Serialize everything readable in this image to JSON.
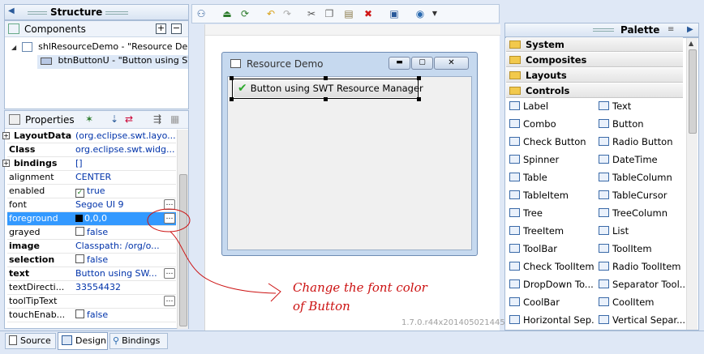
{
  "structure": {
    "title": "Structure",
    "components_label": "Components",
    "tree": [
      "shlResourceDemo - \"Resource Demo\"",
      "btnButtonU - \"Button using SWT Resource Manager\""
    ]
  },
  "properties": {
    "title": "Properties",
    "rows": [
      {
        "name": "LayoutData",
        "value": "(org.eclipse.swt.layo...",
        "bold": true,
        "expand": true
      },
      {
        "name": "Class",
        "value": "org.eclipse.swt.widg...",
        "bold": true
      },
      {
        "name": "bindings",
        "value": "[]",
        "bold": true,
        "expand": true
      },
      {
        "name": "alignment",
        "value": "CENTER"
      },
      {
        "name": "enabled",
        "value": "true",
        "check": true
      },
      {
        "name": "font",
        "value": "Segoe UI 9",
        "dots": true
      },
      {
        "name": "foreground",
        "value": "0,0,0",
        "swatch": true,
        "dots": true,
        "selected": true
      },
      {
        "name": "grayed",
        "value": "false",
        "check": false
      },
      {
        "name": "image",
        "value": "Classpath: /org/o...",
        "bold": true
      },
      {
        "name": "selection",
        "value": "false",
        "bold": true,
        "check": false
      },
      {
        "name": "text",
        "value": "Button using SW...",
        "bold": true,
        "dots": true
      },
      {
        "name": "textDirecti...",
        "value": "33554432"
      },
      {
        "name": "toolTipText",
        "value": "",
        "dots": true
      },
      {
        "name": "touchEnab...",
        "value": "false",
        "check": false
      }
    ]
  },
  "design": {
    "window_title": "Resource Demo",
    "button_text": "Button using SWT Resource Manager",
    "version": "1.7.0.r44x201405021445"
  },
  "palette": {
    "title": "Palette",
    "categories": [
      "System",
      "Composites",
      "Layouts",
      "Controls"
    ],
    "items": [
      [
        "Label",
        "Text"
      ],
      [
        "Combo",
        "Button"
      ],
      [
        "Check Button",
        "Radio Button"
      ],
      [
        "Spinner",
        "DateTime"
      ],
      [
        "Table",
        "TableColumn"
      ],
      [
        "TableItem",
        "TableCursor"
      ],
      [
        "Tree",
        "TreeColumn"
      ],
      [
        "TreeItem",
        "List"
      ],
      [
        "ToolBar",
        "ToolItem"
      ],
      [
        "Check ToolItem",
        "Radio ToolItem"
      ],
      [
        "DropDown To...",
        "Separator Tool..."
      ],
      [
        "CoolBar",
        "CoolItem"
      ],
      [
        "Horizontal Sep...",
        "Vertical Separ..."
      ]
    ]
  },
  "annotation": {
    "line1": "Change the font color",
    "line2": "of Button"
  },
  "bottom_tabs": [
    "Source",
    "Design",
    "Bindings"
  ],
  "colors": {
    "selection": "#3399ff",
    "annotation": "#cc1111"
  }
}
